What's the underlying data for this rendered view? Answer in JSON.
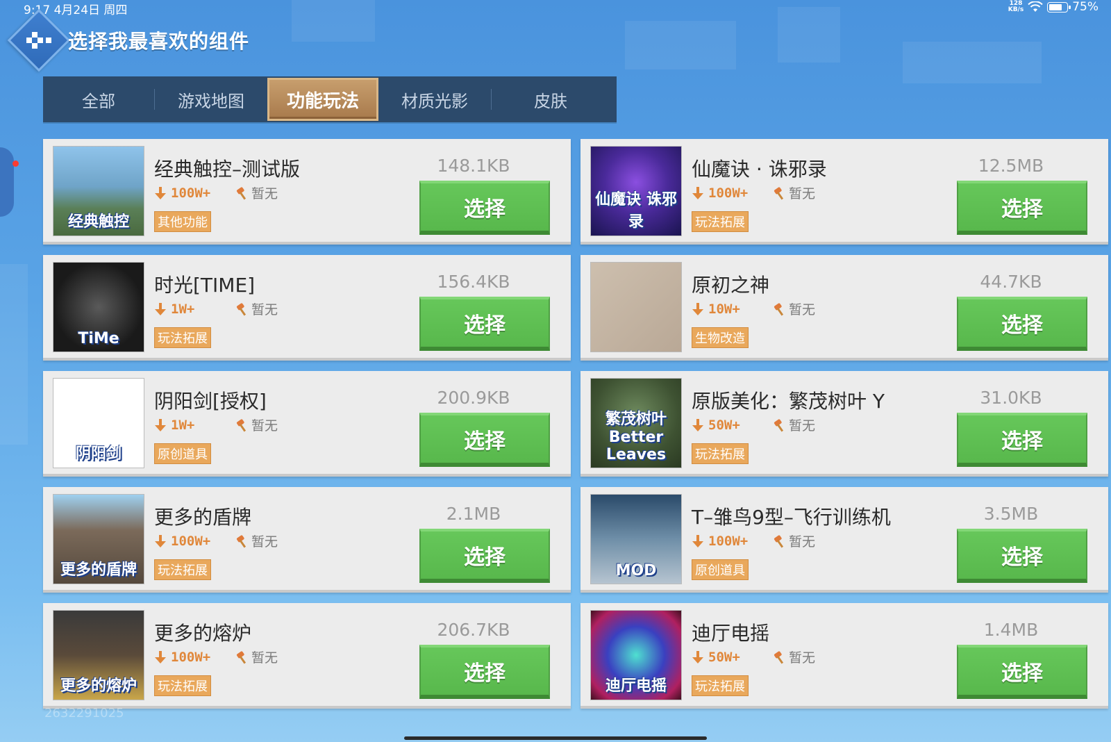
{
  "status_bar": {
    "time_date": "9:17  4月24日 周四",
    "network_speed_value": "128",
    "network_speed_unit": "KB/s",
    "battery": "75%",
    "battery_level": 0.75
  },
  "header": {
    "title": "选择我最喜欢的组件"
  },
  "tabs": [
    {
      "label": "全部"
    },
    {
      "label": "游戏地图"
    },
    {
      "label": "功能玩法",
      "active": true
    },
    {
      "label": "材质光影"
    },
    {
      "label": "皮肤"
    }
  ],
  "select_label": "选择",
  "items": [
    {
      "title": "经典触控–测试版",
      "downloads": "100W+",
      "rating": "暂无",
      "tag": "其他功能",
      "size": "148.1KB",
      "thumb_caption": "经典触控"
    },
    {
      "title": "仙魔诀 · 诛邪录",
      "downloads": "100W+",
      "rating": "暂无",
      "tag": "玩法拓展",
      "size": "12.5MB",
      "thumb_caption": "仙魔诀 诛邪录"
    },
    {
      "title": "时光[TIME]",
      "downloads": "1W+",
      "rating": "暂无",
      "tag": "玩法拓展",
      "size": "156.4KB",
      "thumb_caption": "TiMe"
    },
    {
      "title": "原初之神",
      "downloads": "10W+",
      "rating": "暂无",
      "tag": "生物改造",
      "size": "44.7KB",
      "thumb_caption": ""
    },
    {
      "title": "阴阳剑[授权]",
      "downloads": "1W+",
      "rating": "暂无",
      "tag": "原创道具",
      "size": "200.9KB",
      "thumb_caption": "阴阳剑"
    },
    {
      "title": "原版美化：繁茂树叶 Y",
      "downloads": "50W+",
      "rating": "暂无",
      "tag": "玩法拓展",
      "size": "31.0KB",
      "thumb_caption": "繁茂树叶 Better Leaves"
    },
    {
      "title": "更多的盾牌",
      "downloads": "100W+",
      "rating": "暂无",
      "tag": "玩法拓展",
      "size": "2.1MB",
      "thumb_caption": "更多的盾牌"
    },
    {
      "title": "T–雏鸟9型–飞行训练机",
      "downloads": "100W+",
      "rating": "暂无",
      "tag": "原创道具",
      "size": "3.5MB",
      "thumb_caption": "MOD"
    },
    {
      "title": "更多的熔炉",
      "downloads": "100W+",
      "rating": "暂无",
      "tag": "玩法拓展",
      "size": "206.7KB",
      "thumb_caption": "更多的熔炉"
    },
    {
      "title": "迪厅电摇",
      "downloads": "50W+",
      "rating": "暂无",
      "tag": "玩法拓展",
      "size": "1.4MB",
      "thumb_caption": "迪厅电摇"
    }
  ],
  "footer": {
    "user_id": "2632291025"
  }
}
